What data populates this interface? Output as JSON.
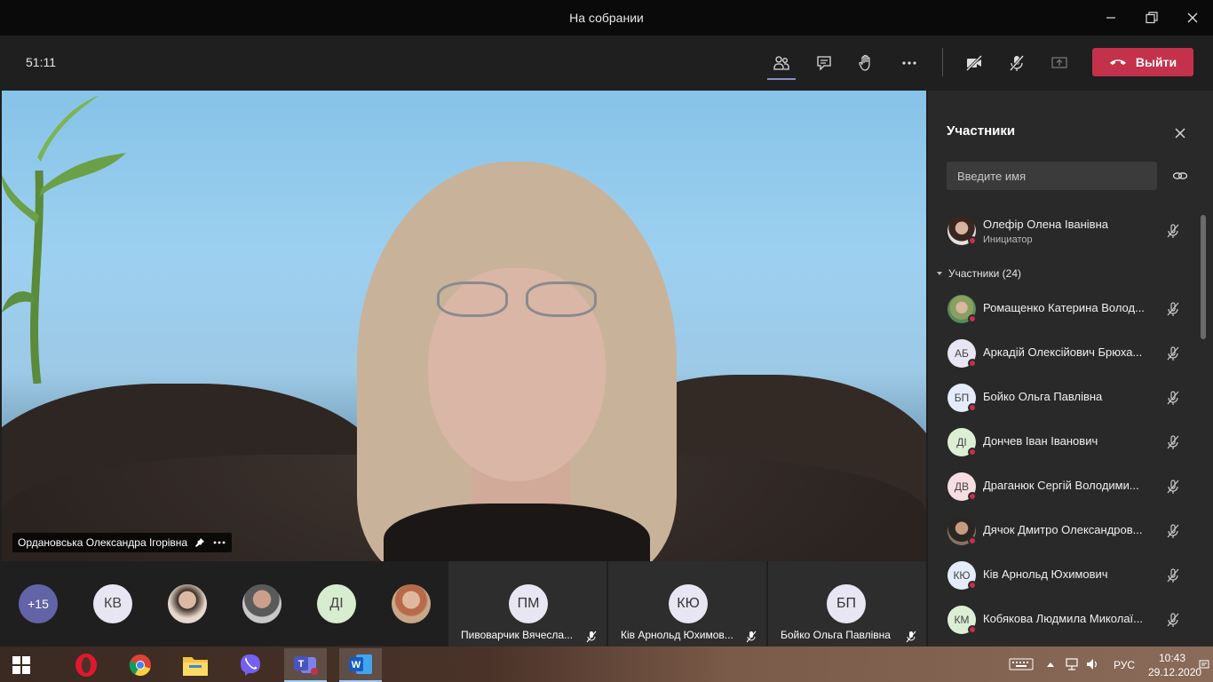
{
  "window": {
    "title": "На собрании"
  },
  "toolbar": {
    "timer": "51:11",
    "leave_label": "Выйти"
  },
  "video": {
    "presenter_name": "Ордановська Олександра Ігорівна"
  },
  "strip": {
    "overflow_count": "+15",
    "initials_1": "КВ",
    "initials_2": "ДІ",
    "tiles": [
      {
        "initials": "ПМ",
        "name": "Пивоварчик Вячесла..."
      },
      {
        "initials": "КЮ",
        "name": "Ків Арнольд Юхимов..."
      },
      {
        "initials": "БП",
        "name": "Бойко Ольга Павлівна"
      }
    ]
  },
  "panel": {
    "title": "Участники",
    "search_placeholder": "Введите имя",
    "organizer": {
      "name": "Олефір Олена Іванівна",
      "role": "Инициатор"
    },
    "section_label": "Участники (24)",
    "participants": [
      {
        "initials": "",
        "name": "Ромащенко Катерина Волод..."
      },
      {
        "initials": "АБ",
        "name": "Аркадій Олексійович Брюха..."
      },
      {
        "initials": "БП",
        "name": "Бойко Ольга Павлівна"
      },
      {
        "initials": "ДІ",
        "name": "Дончев Іван Іванович"
      },
      {
        "initials": "ДВ",
        "name": "Драганюк Сергій Володими..."
      },
      {
        "initials": "",
        "name": "Дячок Дмитро Олександров..."
      },
      {
        "initials": "КЮ",
        "name": "Ків Арнольд Юхимович"
      },
      {
        "initials": "КМ",
        "name": "Кобякова Людмила Миколаї..."
      }
    ]
  },
  "taskbar": {
    "language": "РУС",
    "time": "10:43",
    "date": "29.12.2020"
  },
  "colors": {
    "accent": "#8b8cc7",
    "leave": "#c4314b",
    "panel": "#292929"
  }
}
